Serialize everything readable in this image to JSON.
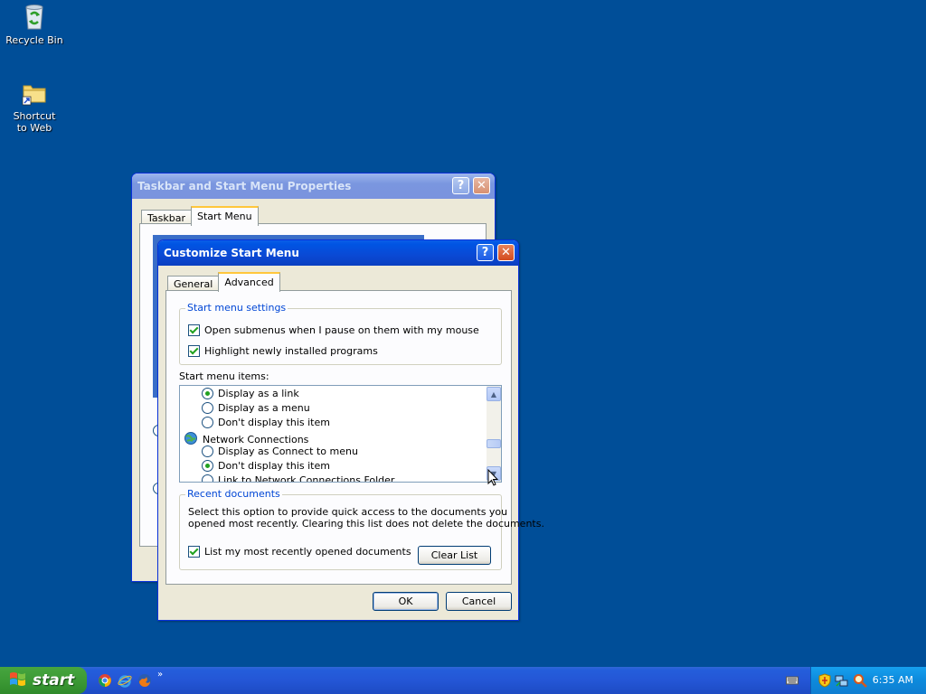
{
  "desktop": {
    "icons": [
      {
        "label": "Recycle Bin"
      },
      {
        "label": "Shortcut to Web"
      }
    ]
  },
  "parent_window": {
    "title": "Taskbar and Start Menu Properties",
    "tabs": [
      {
        "label": "Taskbar"
      },
      {
        "label": "Start Menu"
      }
    ]
  },
  "dialog": {
    "title": "Customize Start Menu",
    "tabs": [
      {
        "label": "General"
      },
      {
        "label": "Advanced"
      }
    ],
    "start_menu_settings": {
      "title": "Start menu settings",
      "options": [
        {
          "label": "Open submenus when I pause on them with my mouse",
          "checked": true
        },
        {
          "label": "Highlight newly installed programs",
          "checked": true
        }
      ]
    },
    "start_menu_items": {
      "label": "Start menu items:",
      "rows": [
        {
          "type": "radio",
          "label": "Display as a link",
          "checked": true
        },
        {
          "type": "radio",
          "label": "Display as a menu",
          "checked": false
        },
        {
          "type": "radio",
          "label": "Don't display this item",
          "checked": false
        },
        {
          "type": "header",
          "label": "Network Connections"
        },
        {
          "type": "radio",
          "label": "Display as Connect to menu",
          "checked": false
        },
        {
          "type": "radio",
          "label": "Don't display this item",
          "checked": true
        },
        {
          "type": "radio",
          "label": "Link to Network Connections Folder",
          "checked": false
        }
      ]
    },
    "recent_documents": {
      "title": "Recent documents",
      "description_line1": "Select this option to provide quick access to the documents you",
      "description_line2": "opened most recently.  Clearing this list does not delete the documents.",
      "option_label": "List my most recently opened documents",
      "option_checked": true,
      "clear_button": "Clear List"
    },
    "ok_button": "OK",
    "cancel_button": "Cancel"
  },
  "taskbar": {
    "start_label": "start",
    "clock": "6:35 AM"
  }
}
